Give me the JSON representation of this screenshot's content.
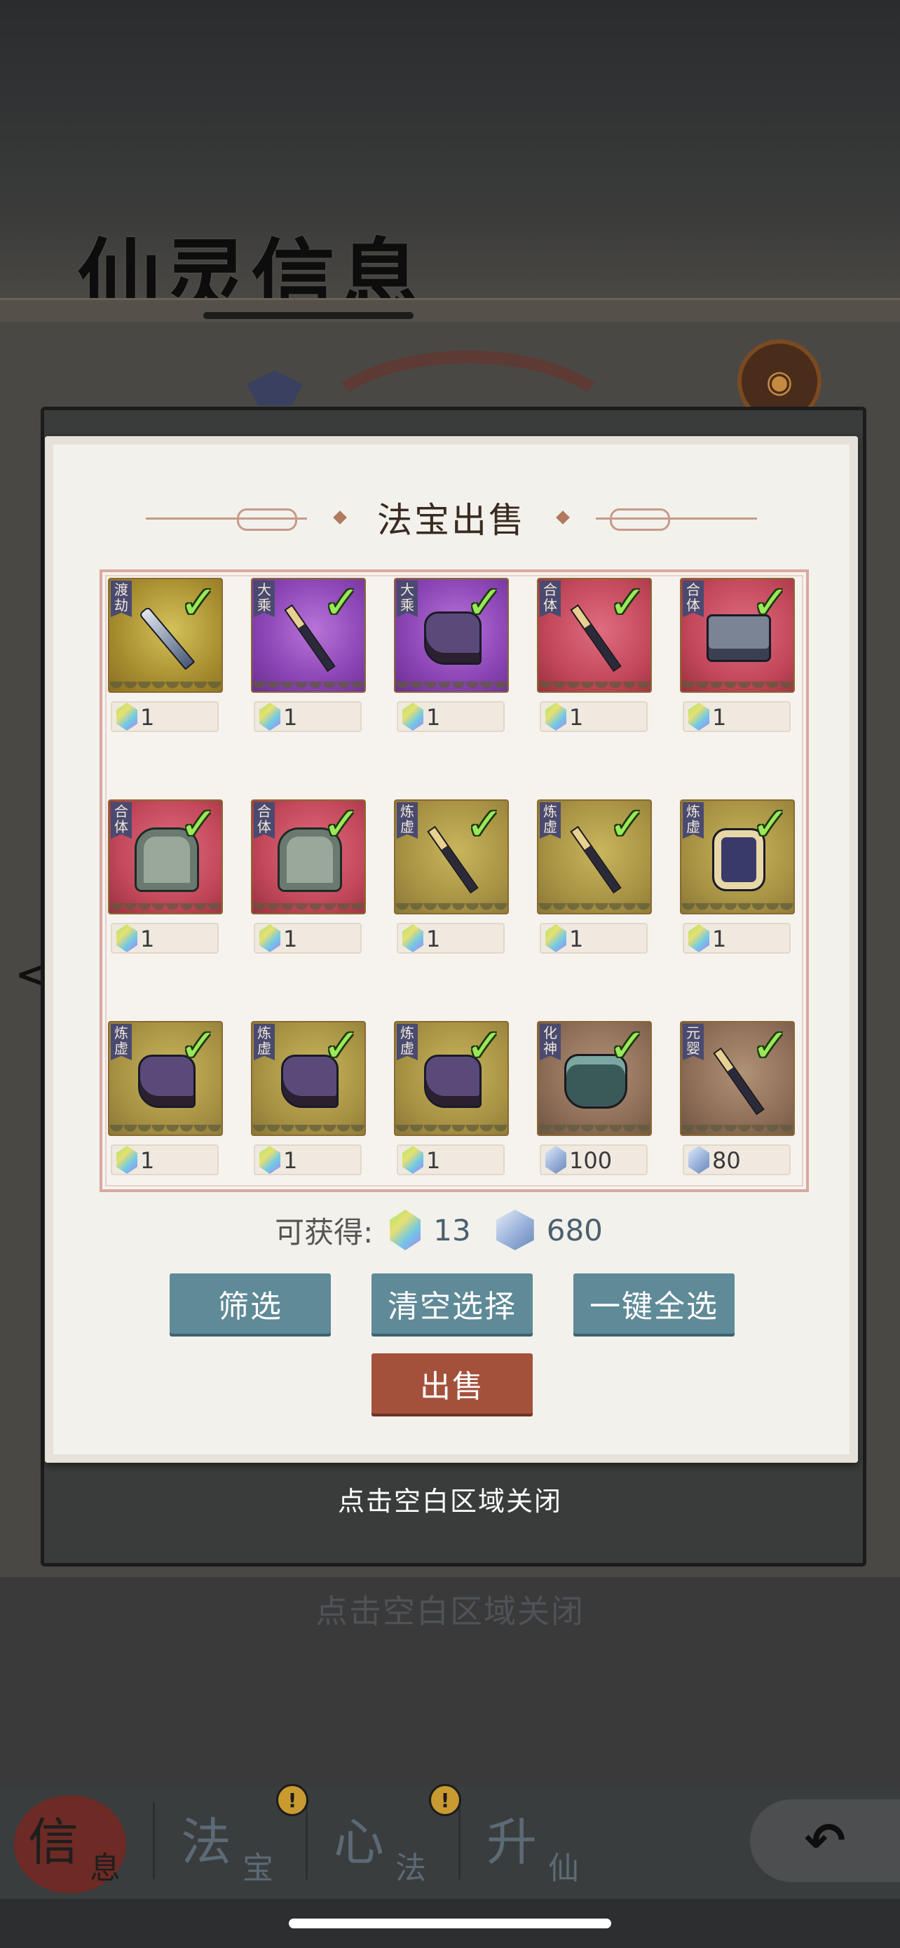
{
  "background": {
    "page_title": "仙灵信息",
    "close_hint": "点击空白区域关闭",
    "emblem_glyph": "◉"
  },
  "modal": {
    "title": "法宝出售",
    "items": [
      {
        "rank": "渡劫",
        "quality": "gold",
        "icon": "sword-icon",
        "selected": true,
        "currency": "spirit-gem",
        "price": "1"
      },
      {
        "rank": "大乘",
        "quality": "purple",
        "icon": "spear-icon",
        "selected": true,
        "currency": "spirit-gem",
        "price": "1"
      },
      {
        "rank": "大乘",
        "quality": "purple",
        "icon": "boot-icon",
        "selected": true,
        "currency": "spirit-gem",
        "price": "1"
      },
      {
        "rank": "合体",
        "quality": "red",
        "icon": "spear-icon",
        "selected": true,
        "currency": "spirit-gem",
        "price": "1"
      },
      {
        "rank": "合体",
        "quality": "red",
        "icon": "cart-icon",
        "selected": true,
        "currency": "spirit-gem",
        "price": "1"
      },
      {
        "rank": "合体",
        "quality": "red",
        "icon": "robe-icon",
        "selected": true,
        "currency": "spirit-gem",
        "price": "1"
      },
      {
        "rank": "合体",
        "quality": "red",
        "icon": "robe-icon",
        "selected": true,
        "currency": "spirit-gem",
        "price": "1"
      },
      {
        "rank": "炼虚",
        "quality": "olive",
        "icon": "spear-icon",
        "selected": true,
        "currency": "spirit-gem",
        "price": "1"
      },
      {
        "rank": "炼虚",
        "quality": "olive",
        "icon": "spear-icon",
        "selected": true,
        "currency": "spirit-gem",
        "price": "1"
      },
      {
        "rank": "炼虚",
        "quality": "olive",
        "icon": "lantern-icon",
        "selected": true,
        "currency": "spirit-gem",
        "price": "1"
      },
      {
        "rank": "炼虚",
        "quality": "olive",
        "icon": "boot-icon",
        "selected": true,
        "currency": "spirit-gem",
        "price": "1"
      },
      {
        "rank": "炼虚",
        "quality": "olive",
        "icon": "boot-icon",
        "selected": true,
        "currency": "spirit-gem",
        "price": "1"
      },
      {
        "rank": "炼虚",
        "quality": "olive",
        "icon": "boot-icon",
        "selected": true,
        "currency": "spirit-gem",
        "price": "1"
      },
      {
        "rank": "化神",
        "quality": "brown",
        "icon": "cauldron-icon",
        "selected": true,
        "currency": "crystal",
        "price": "100"
      },
      {
        "rank": "元婴",
        "quality": "brown",
        "icon": "spear-icon",
        "selected": true,
        "currency": "crystal",
        "price": "80"
      }
    ],
    "gain_label": "可获得:",
    "gain_spirit": "13",
    "gain_crystal": "680",
    "buttons": {
      "filter": "筛选",
      "clear": "清空选择",
      "select_all": "一键全选",
      "sell": "出售"
    },
    "close_hint": "点击空白区域关闭"
  },
  "nav": {
    "tabs": [
      {
        "big": "信",
        "small": "息",
        "active": true,
        "badge": ""
      },
      {
        "big": "法",
        "small": "宝",
        "active": false,
        "badge": "!"
      },
      {
        "big": "心",
        "small": "法",
        "active": false,
        "badge": "!"
      },
      {
        "big": "升",
        "small": "仙",
        "active": false,
        "badge": ""
      }
    ],
    "back_glyph": "↶"
  },
  "colors": {
    "accent_teal": "#5f8a98",
    "sell_red": "#a4513c",
    "check_green": "#9be85a"
  }
}
